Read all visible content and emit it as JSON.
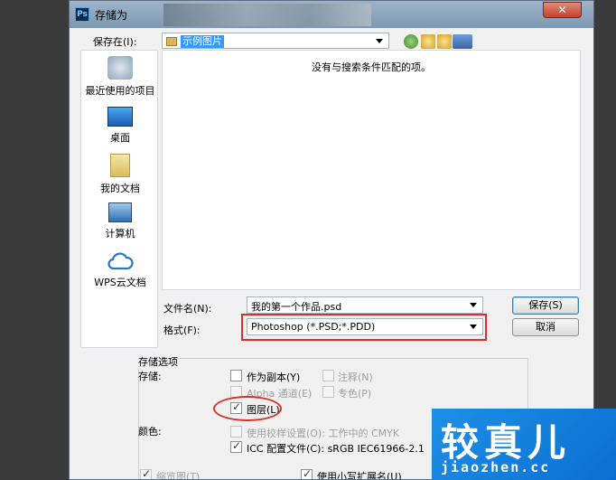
{
  "window": {
    "title": "存储为",
    "app_icon": "Ps",
    "close_symbol": "✕"
  },
  "save_in": {
    "label": "保存在(I):",
    "value": "示例图片"
  },
  "places": [
    {
      "label": "最近使用的项目",
      "icon": "recent-icon"
    },
    {
      "label": "桌面",
      "icon": "desktop-icon"
    },
    {
      "label": "我的文档",
      "icon": "documents-icon"
    },
    {
      "label": "计算机",
      "icon": "computer-icon"
    },
    {
      "label": "WPS云文档",
      "icon": "cloud-icon"
    }
  ],
  "file_list": {
    "empty_message": "没有与搜索条件匹配的项。"
  },
  "filename": {
    "label": "文件名(N):",
    "value": "我的第一个作品.psd"
  },
  "format": {
    "label": "格式(F):",
    "value": "Photoshop (*.PSD;*.PDD)"
  },
  "buttons": {
    "save": "保存(S)",
    "cancel": "取消"
  },
  "options": {
    "group_label": "存储选项",
    "storage_label": "存储:",
    "as_copy": "作为副本(Y)",
    "notes": "注释(N)",
    "alpha": "Alpha 通道(E)",
    "spot": "专色(P)",
    "layers": "图层(L)",
    "color_label": "颜色:",
    "proof": "使用校样设置(O): 工作中的 CMYK",
    "icc": "ICC 配置文件(C): sRGB IEC61966-2.1",
    "thumbnail": "缩览图(T)",
    "lowercase_ext": "使用小写扩展名(U)"
  },
  "watermark": {
    "big": "较真儿",
    "small": "jiaozhen.cc"
  },
  "colors": {
    "accent": "#3399ff",
    "highlight": "#d9302b",
    "watermark": "#1e8fe6"
  }
}
